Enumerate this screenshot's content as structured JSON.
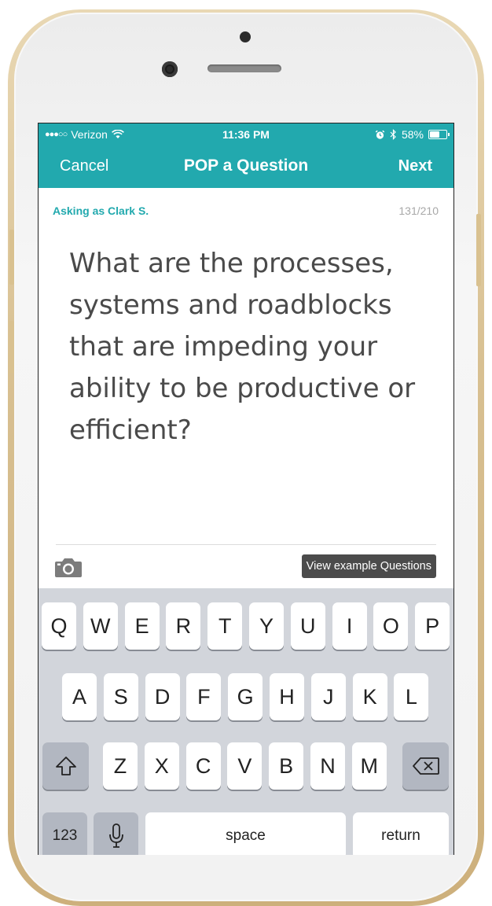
{
  "status_bar": {
    "signal": "●●●○○",
    "carrier": "Verizon",
    "wifi_icon": "wifi-icon",
    "time": "11:36 PM",
    "alarm_icon": "alarm-icon",
    "bluetooth_icon": "bluetooth-icon",
    "battery_percent": "58%",
    "battery_level": 0.58
  },
  "nav": {
    "cancel_label": "Cancel",
    "title": "POP a Question",
    "next_label": "Next"
  },
  "compose": {
    "asking_as": "Asking as Clark S.",
    "char_count": "131/210",
    "question_text": "What are the processes, systems and roadblocks that are impeding your ability to be productive or efficient?",
    "camera_icon": "camera-icon",
    "examples_button": "View example Questions"
  },
  "keyboard": {
    "row1": [
      "Q",
      "W",
      "E",
      "R",
      "T",
      "Y",
      "U",
      "I",
      "O",
      "P"
    ],
    "row2": [
      "A",
      "S",
      "D",
      "F",
      "G",
      "H",
      "J",
      "K",
      "L"
    ],
    "row3": [
      "Z",
      "X",
      "C",
      "V",
      "B",
      "N",
      "M"
    ],
    "shift_icon": "shift-icon",
    "backspace_icon": "backspace-icon",
    "numbers_label": "123",
    "mic_icon": "microphone-icon",
    "space_label": "space",
    "return_label": "return"
  },
  "colors": {
    "accent": "#22a9ae",
    "phone_gold": "#d8c092",
    "button_dark": "#4b4b4b"
  }
}
